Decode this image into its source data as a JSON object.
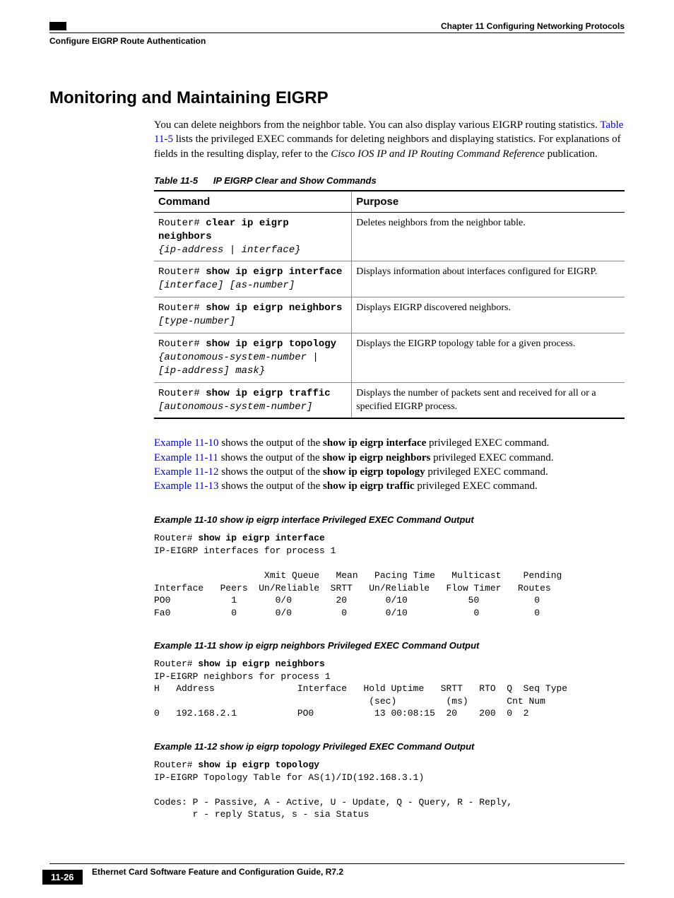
{
  "header": {
    "chapter": "Chapter 11    Configuring Networking Protocols",
    "section": "Configure EIGRP Route Authentication"
  },
  "heading": "Monitoring and Maintaining EIGRP",
  "intro": {
    "s1": "You can delete neighbors from the neighbor table. You can also display various EIGRP routing statistics. ",
    "link": "Table 11-5",
    "s2": " lists the privileged EXEC commands for deleting neighbors and displaying statistics. For explanations of fields in the resulting display, refer to the ",
    "ital": "Cisco IOS IP and IP Routing Command Reference",
    "s3": " publication."
  },
  "table": {
    "caption_label": "Table 11-5",
    "caption_text": "IP EIGRP Clear and Show Commands",
    "head_cmd": "Command",
    "head_purpose": "Purpose",
    "rows": [
      {
        "prompt": "Router# ",
        "bold": "clear ip eigrp neighbors",
        "args": "{ip-address | interface}",
        "purpose": "Deletes neighbors from the neighbor table."
      },
      {
        "prompt": "Router# ",
        "bold": "show ip eigrp interface",
        "args": "[interface] [as-number]",
        "purpose": "Displays information about interfaces configured for EIGRP."
      },
      {
        "prompt": "Router# ",
        "bold": "show ip eigrp neighbors",
        "args": "[type-number]",
        "purpose": "Displays EIGRP discovered neighbors."
      },
      {
        "prompt": "Router# ",
        "bold": "show ip eigrp topology",
        "args": "{autonomous-system-number | [ip-address] mask}",
        "purpose": "Displays the EIGRP topology table for a given process."
      },
      {
        "prompt": "Router# ",
        "bold": "show ip eigrp traffic",
        "args": "[autonomous-system-number]",
        "purpose": "Displays the number of packets sent and received for all or a specified EIGRP process."
      }
    ]
  },
  "refs": {
    "r1_link": "Example 11-10",
    "r1_a": " shows the output of the ",
    "r1_b": "show ip eigrp interface",
    "r1_c": " privileged EXEC command.",
    "r2_link": "Example 11-11",
    "r2_a": " shows the output of the ",
    "r2_b": "show ip eigrp neighbors",
    "r2_c": " privileged EXEC command.",
    "r3_link": "Example 11-12",
    "r3_a": " shows the output of the ",
    "r3_b": "show ip eigrp topology",
    "r3_c": " privileged EXEC command.",
    "r4_link": "Example 11-13",
    "r4_a": " shows the output of the ",
    "r4_b": "show ip eigrp traffic",
    "r4_c": " privileged EXEC command."
  },
  "ex10": {
    "caption": "Example 11-10  show ip eigrp interface Privileged EXEC Command Output",
    "prompt": "Router# ",
    "cmd": "show ip eigrp interface",
    "body": "IP-EIGRP interfaces for process 1\n\n                    Xmit Queue   Mean   Pacing Time   Multicast    Pending\nInterface   Peers  Un/Reliable  SRTT   Un/Reliable   Flow Timer   Routes\nPO0           1       0/0        20       0/10           50          0\nFa0           0       0/0         0       0/10            0          0"
  },
  "ex11": {
    "caption": "Example 11-11  show ip eigrp neighbors Privileged EXEC Command Output",
    "prompt": "Router# ",
    "cmd": "show ip eigrp neighbors",
    "body": "IP-EIGRP neighbors for process 1\nH   Address               Interface   Hold Uptime   SRTT   RTO  Q  Seq Type\n                                       (sec)         (ms)       Cnt Num\n0   192.168.2.1           PO0           13 00:08:15  20    200  0  2"
  },
  "ex12": {
    "caption": "Example 11-12  show ip eigrp topology Privileged EXEC Command Output",
    "prompt": "Router# ",
    "cmd": "show ip eigrp topology",
    "body": "IP-EIGRP Topology Table for AS(1)/ID(192.168.3.1)\n\nCodes: P - Passive, A - Active, U - Update, Q - Query, R - Reply,\n       r - reply Status, s - sia Status"
  },
  "footer": {
    "book": "Ethernet Card Software Feature and Configuration Guide, R7.2",
    "page": "11-26"
  }
}
